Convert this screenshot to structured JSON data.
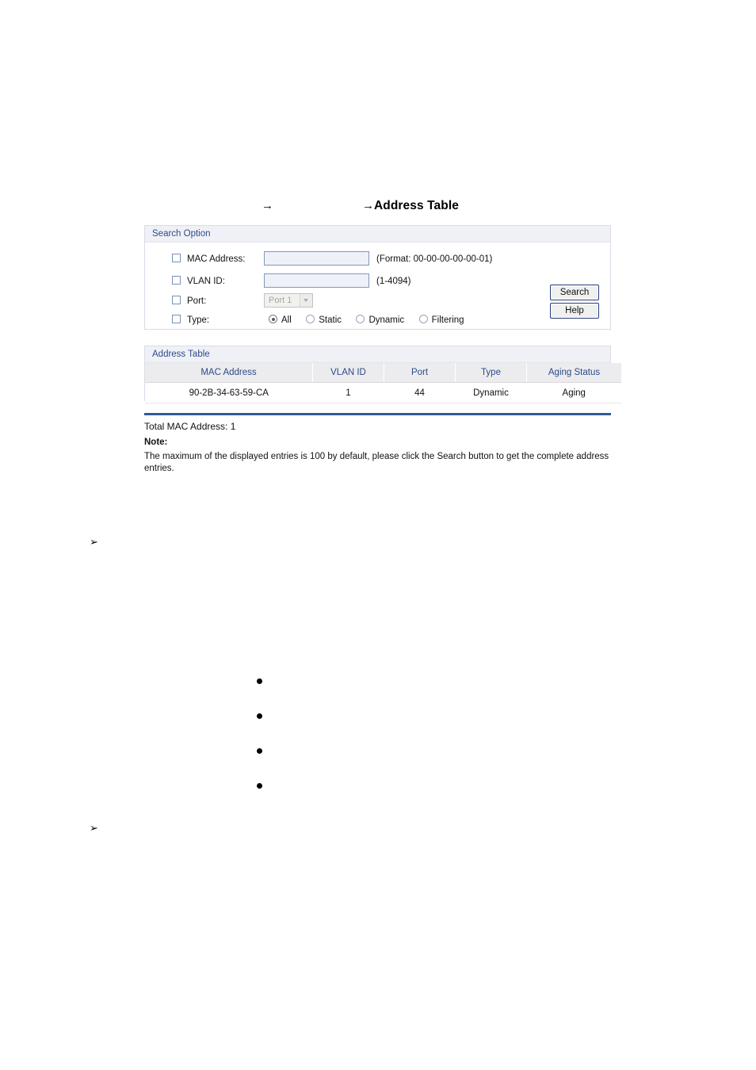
{
  "title": {
    "arrow_1": "→",
    "arrow_2": "→",
    "text": "Address Table"
  },
  "search_option": {
    "panel_title": "Search Option",
    "rows": [
      {
        "label": "MAC Address:",
        "value": "",
        "hint": "(Format: 00-00-00-00-00-01)",
        "checked": false
      },
      {
        "label": "VLAN ID:",
        "value": "",
        "hint": "(1-4094)",
        "checked": false
      },
      {
        "label": "Port:",
        "selected_option": "Port 1",
        "checked": false
      },
      {
        "label": "Type:",
        "checked": false
      }
    ],
    "type_options": [
      {
        "label": "All",
        "selected": true
      },
      {
        "label": "Static",
        "selected": false
      },
      {
        "label": "Dynamic",
        "selected": false
      },
      {
        "label": "Filtering",
        "selected": false
      }
    ],
    "search_button": "Search",
    "help_button": "Help"
  },
  "address_table": {
    "panel_title": "Address Table",
    "columns": [
      "MAC Address",
      "VLAN ID",
      "Port",
      "Type",
      "Aging Status"
    ],
    "rows": [
      {
        "mac_address": "90-2B-34-63-59-CA",
        "vlan_id": "1",
        "port": "44",
        "type": "Dynamic",
        "aging_status": "Aging"
      }
    ]
  },
  "footer": {
    "total": "Total MAC Address: 1",
    "note_label": "Note:",
    "note_body": "The maximum of the displayed entries is 100 by default, please click the Search button to get the complete address entries."
  },
  "markers": {
    "arrow": "➢",
    "bullet": "•"
  },
  "colors": {
    "panel_header_text": "#2d4a8a",
    "panel_header_bg": "#f0f1f6",
    "table_header_bg": "#ececee",
    "divider_blue": "#2f5a96",
    "input_bg": "#eef1f8",
    "button_border": "#2a3f7a"
  }
}
